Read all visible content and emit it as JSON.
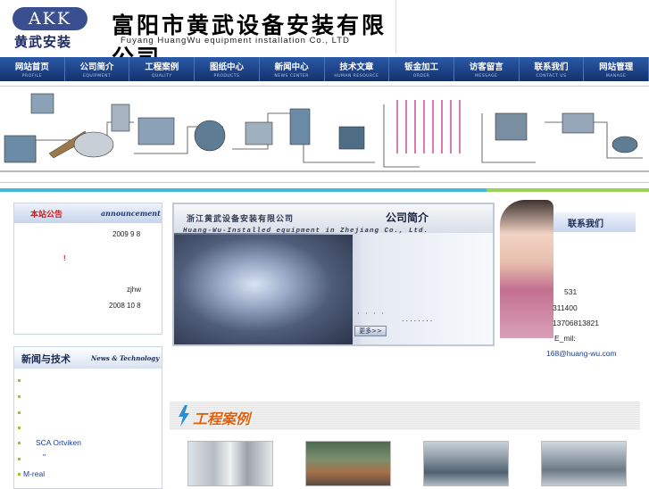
{
  "header": {
    "logo_text": "AKK",
    "logo_cn": "黄武安装",
    "company_cn": "富阳市黄武设备安装有限公司",
    "company_en": "Fuyang HuangWu equipment installation Co., LTD"
  },
  "nav": [
    {
      "cn": "网站首页",
      "en": "PROFILE"
    },
    {
      "cn": "公司简介",
      "en": "EQUIPMENT"
    },
    {
      "cn": "工程案例",
      "en": "QUALITY"
    },
    {
      "cn": "图纸中心",
      "en": "PRODUCTS"
    },
    {
      "cn": "新闻中心",
      "en": "NEWS CENTER"
    },
    {
      "cn": "技术文章",
      "en": "HUMAN RESOURCE"
    },
    {
      "cn": "钣金加工",
      "en": "ORDER"
    },
    {
      "cn": "访客留言",
      "en": "MESSAGE"
    },
    {
      "cn": "联系我们",
      "en": "CONTACT US"
    },
    {
      "cn": "网站管理",
      "en": "MANAGE"
    }
  ],
  "notice": {
    "title_cn": "本站公告",
    "title_en": "announcement",
    "date1": "2009 9 8",
    "mark": "!",
    "author": "zjhw",
    "date2": "2008 10 8"
  },
  "news": {
    "title_cn": "新闻与技术",
    "title_en": "News & Technology",
    "items": [
      "",
      "",
      "",
      "",
      "SCA Ortviken",
      "\"",
      "M-real"
    ]
  },
  "intro": {
    "title_cn": "浙江黄武设备安装有限公司",
    "section": "公司简介",
    "title_en": "Huang-Wu-Installed equipment in Zhejiang Co., Ltd.",
    "dots1": "· · · ·",
    "dots2": "........",
    "more": "更多>>"
  },
  "contact": {
    "title": "联系我们",
    "line1": "531",
    "line2": "311400",
    "phone": "13706813821",
    "email_label": "E_mil:",
    "email": "168@huang-wu.com"
  },
  "cases": {
    "title": "工程案例"
  },
  "colors": {
    "nav_top": "#2b5aa8",
    "nav_bottom": "#13306c",
    "stripe_blue": "#45b7d8",
    "stripe_green": "#9bd35a",
    "notice_red": "#c81e1e",
    "cases_orange": "#e0600e"
  }
}
